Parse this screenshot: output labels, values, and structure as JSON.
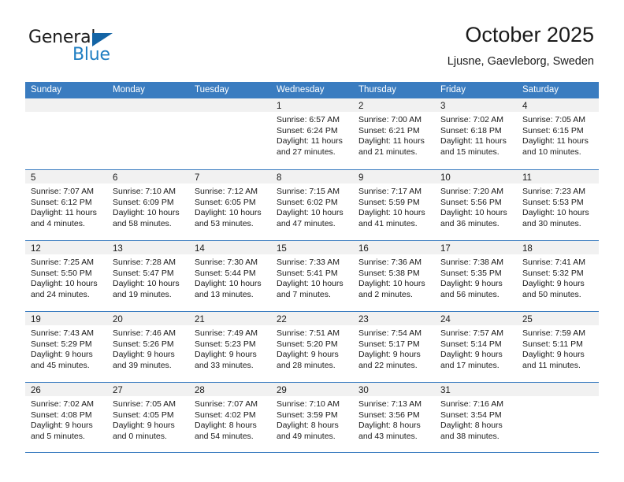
{
  "brand": {
    "name_top": "General",
    "name_bottom": "Blue",
    "accent_color": "#1f7ec2",
    "triangle_color": "#1464a5"
  },
  "header": {
    "title": "October 2025",
    "subtitle": "Ljusne, Gaevleborg, Sweden"
  },
  "calendar": {
    "header_bg": "#3a7cc0",
    "header_text_color": "#ffffff",
    "daynum_band_bg": "#f1f1f1",
    "weekday_headers": [
      "Sunday",
      "Monday",
      "Tuesday",
      "Wednesday",
      "Thursday",
      "Friday",
      "Saturday"
    ],
    "weeks": [
      [
        {
          "day": "",
          "lines": []
        },
        {
          "day": "",
          "lines": []
        },
        {
          "day": "",
          "lines": []
        },
        {
          "day": "1",
          "lines": [
            "Sunrise: 6:57 AM",
            "Sunset: 6:24 PM",
            "Daylight: 11 hours",
            "and 27 minutes."
          ]
        },
        {
          "day": "2",
          "lines": [
            "Sunrise: 7:00 AM",
            "Sunset: 6:21 PM",
            "Daylight: 11 hours",
            "and 21 minutes."
          ]
        },
        {
          "day": "3",
          "lines": [
            "Sunrise: 7:02 AM",
            "Sunset: 6:18 PM",
            "Daylight: 11 hours",
            "and 15 minutes."
          ]
        },
        {
          "day": "4",
          "lines": [
            "Sunrise: 7:05 AM",
            "Sunset: 6:15 PM",
            "Daylight: 11 hours",
            "and 10 minutes."
          ]
        }
      ],
      [
        {
          "day": "5",
          "lines": [
            "Sunrise: 7:07 AM",
            "Sunset: 6:12 PM",
            "Daylight: 11 hours",
            "and 4 minutes."
          ]
        },
        {
          "day": "6",
          "lines": [
            "Sunrise: 7:10 AM",
            "Sunset: 6:09 PM",
            "Daylight: 10 hours",
            "and 58 minutes."
          ]
        },
        {
          "day": "7",
          "lines": [
            "Sunrise: 7:12 AM",
            "Sunset: 6:05 PM",
            "Daylight: 10 hours",
            "and 53 minutes."
          ]
        },
        {
          "day": "8",
          "lines": [
            "Sunrise: 7:15 AM",
            "Sunset: 6:02 PM",
            "Daylight: 10 hours",
            "and 47 minutes."
          ]
        },
        {
          "day": "9",
          "lines": [
            "Sunrise: 7:17 AM",
            "Sunset: 5:59 PM",
            "Daylight: 10 hours",
            "and 41 minutes."
          ]
        },
        {
          "day": "10",
          "lines": [
            "Sunrise: 7:20 AM",
            "Sunset: 5:56 PM",
            "Daylight: 10 hours",
            "and 36 minutes."
          ]
        },
        {
          "day": "11",
          "lines": [
            "Sunrise: 7:23 AM",
            "Sunset: 5:53 PM",
            "Daylight: 10 hours",
            "and 30 minutes."
          ]
        }
      ],
      [
        {
          "day": "12",
          "lines": [
            "Sunrise: 7:25 AM",
            "Sunset: 5:50 PM",
            "Daylight: 10 hours",
            "and 24 minutes."
          ]
        },
        {
          "day": "13",
          "lines": [
            "Sunrise: 7:28 AM",
            "Sunset: 5:47 PM",
            "Daylight: 10 hours",
            "and 19 minutes."
          ]
        },
        {
          "day": "14",
          "lines": [
            "Sunrise: 7:30 AM",
            "Sunset: 5:44 PM",
            "Daylight: 10 hours",
            "and 13 minutes."
          ]
        },
        {
          "day": "15",
          "lines": [
            "Sunrise: 7:33 AM",
            "Sunset: 5:41 PM",
            "Daylight: 10 hours",
            "and 7 minutes."
          ]
        },
        {
          "day": "16",
          "lines": [
            "Sunrise: 7:36 AM",
            "Sunset: 5:38 PM",
            "Daylight: 10 hours",
            "and 2 minutes."
          ]
        },
        {
          "day": "17",
          "lines": [
            "Sunrise: 7:38 AM",
            "Sunset: 5:35 PM",
            "Daylight: 9 hours",
            "and 56 minutes."
          ]
        },
        {
          "day": "18",
          "lines": [
            "Sunrise: 7:41 AM",
            "Sunset: 5:32 PM",
            "Daylight: 9 hours",
            "and 50 minutes."
          ]
        }
      ],
      [
        {
          "day": "19",
          "lines": [
            "Sunrise: 7:43 AM",
            "Sunset: 5:29 PM",
            "Daylight: 9 hours",
            "and 45 minutes."
          ]
        },
        {
          "day": "20",
          "lines": [
            "Sunrise: 7:46 AM",
            "Sunset: 5:26 PM",
            "Daylight: 9 hours",
            "and 39 minutes."
          ]
        },
        {
          "day": "21",
          "lines": [
            "Sunrise: 7:49 AM",
            "Sunset: 5:23 PM",
            "Daylight: 9 hours",
            "and 33 minutes."
          ]
        },
        {
          "day": "22",
          "lines": [
            "Sunrise: 7:51 AM",
            "Sunset: 5:20 PM",
            "Daylight: 9 hours",
            "and 28 minutes."
          ]
        },
        {
          "day": "23",
          "lines": [
            "Sunrise: 7:54 AM",
            "Sunset: 5:17 PM",
            "Daylight: 9 hours",
            "and 22 minutes."
          ]
        },
        {
          "day": "24",
          "lines": [
            "Sunrise: 7:57 AM",
            "Sunset: 5:14 PM",
            "Daylight: 9 hours",
            "and 17 minutes."
          ]
        },
        {
          "day": "25",
          "lines": [
            "Sunrise: 7:59 AM",
            "Sunset: 5:11 PM",
            "Daylight: 9 hours",
            "and 11 minutes."
          ]
        }
      ],
      [
        {
          "day": "26",
          "lines": [
            "Sunrise: 7:02 AM",
            "Sunset: 4:08 PM",
            "Daylight: 9 hours",
            "and 5 minutes."
          ]
        },
        {
          "day": "27",
          "lines": [
            "Sunrise: 7:05 AM",
            "Sunset: 4:05 PM",
            "Daylight: 9 hours",
            "and 0 minutes."
          ]
        },
        {
          "day": "28",
          "lines": [
            "Sunrise: 7:07 AM",
            "Sunset: 4:02 PM",
            "Daylight: 8 hours",
            "and 54 minutes."
          ]
        },
        {
          "day": "29",
          "lines": [
            "Sunrise: 7:10 AM",
            "Sunset: 3:59 PM",
            "Daylight: 8 hours",
            "and 49 minutes."
          ]
        },
        {
          "day": "30",
          "lines": [
            "Sunrise: 7:13 AM",
            "Sunset: 3:56 PM",
            "Daylight: 8 hours",
            "and 43 minutes."
          ]
        },
        {
          "day": "31",
          "lines": [
            "Sunrise: 7:16 AM",
            "Sunset: 3:54 PM",
            "Daylight: 8 hours",
            "and 38 minutes."
          ]
        },
        {
          "day": "",
          "lines": []
        }
      ]
    ]
  }
}
